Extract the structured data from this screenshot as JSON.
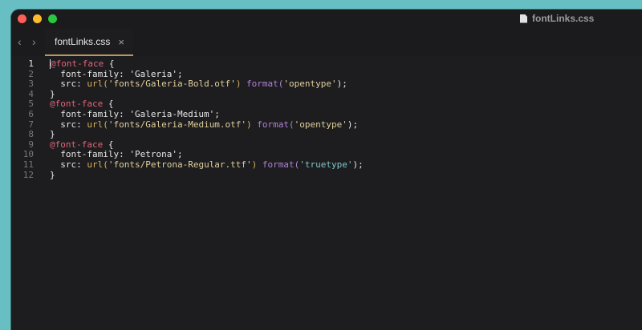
{
  "window": {
    "title": "fontLinks.css"
  },
  "tab": {
    "label": "fontLinks.css",
    "close": "×"
  },
  "nav": {
    "back": "‹",
    "forward": "›"
  },
  "code": {
    "lines": [
      {
        "num": "1",
        "tokens": [
          {
            "t": "@font-face",
            "c": "kw"
          },
          {
            "t": " {",
            "c": "prop"
          }
        ]
      },
      {
        "num": "2",
        "tokens": [
          {
            "t": "  font-family: 'Galeria';",
            "c": "prop"
          }
        ]
      },
      {
        "num": "3",
        "tokens": [
          {
            "t": "  src: ",
            "c": "prop"
          },
          {
            "t": "url(",
            "c": "fn"
          },
          {
            "t": "'fonts/Galeria-Bold.otf'",
            "c": "str"
          },
          {
            "t": ")",
            "c": "fn"
          },
          {
            "t": " format(",
            "c": "pf"
          },
          {
            "t": "'opentype'",
            "c": "str"
          },
          {
            "t": ");",
            "c": "prop"
          }
        ]
      },
      {
        "num": "4",
        "tokens": [
          {
            "t": "}",
            "c": "prop"
          }
        ]
      },
      {
        "num": "5",
        "tokens": [
          {
            "t": "@font-face",
            "c": "kw"
          },
          {
            "t": " {",
            "c": "prop"
          }
        ]
      },
      {
        "num": "6",
        "tokens": [
          {
            "t": "  font-family: 'Galeria-Medium';",
            "c": "prop"
          }
        ]
      },
      {
        "num": "7",
        "tokens": [
          {
            "t": "  src: ",
            "c": "prop"
          },
          {
            "t": "url(",
            "c": "fn"
          },
          {
            "t": "'fonts/Galeria-Medium.otf'",
            "c": "str"
          },
          {
            "t": ")",
            "c": "fn"
          },
          {
            "t": " format(",
            "c": "pf"
          },
          {
            "t": "'opentype'",
            "c": "str"
          },
          {
            "t": ");",
            "c": "prop"
          }
        ]
      },
      {
        "num": "8",
        "tokens": [
          {
            "t": "}",
            "c": "prop"
          }
        ]
      },
      {
        "num": "9",
        "tokens": [
          {
            "t": "@font-face",
            "c": "kw"
          },
          {
            "t": " {",
            "c": "prop"
          }
        ]
      },
      {
        "num": "10",
        "tokens": [
          {
            "t": "  font-family: 'Petrona';",
            "c": "prop"
          }
        ]
      },
      {
        "num": "11",
        "tokens": [
          {
            "t": "  src: ",
            "c": "prop"
          },
          {
            "t": "url(",
            "c": "fn"
          },
          {
            "t": "'fonts/Petrona-Regular.ttf'",
            "c": "str"
          },
          {
            "t": ")",
            "c": "fn"
          },
          {
            "t": " format(",
            "c": "pf"
          },
          {
            "t": "'truetype'",
            "c": "strc"
          },
          {
            "t": ");",
            "c": "prop"
          }
        ]
      },
      {
        "num": "12",
        "tokens": [
          {
            "t": "}",
            "c": "prop"
          }
        ]
      }
    ]
  }
}
